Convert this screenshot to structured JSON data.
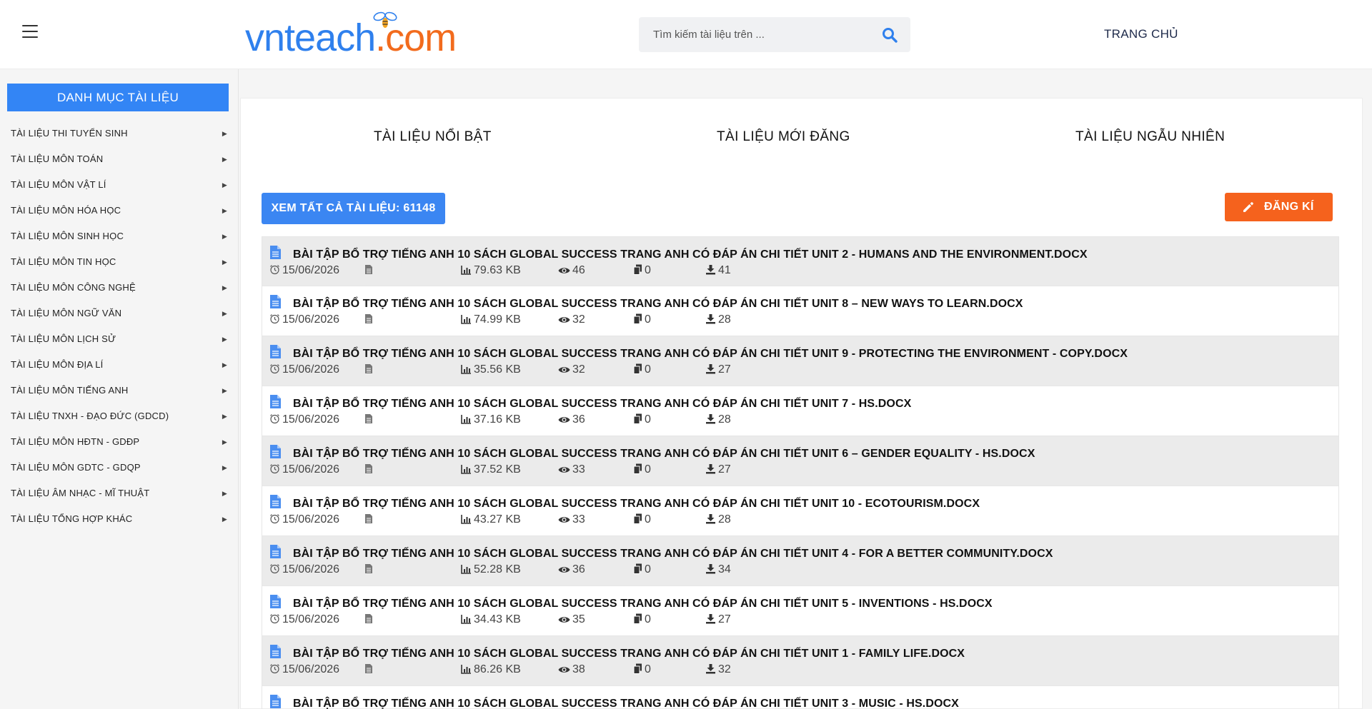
{
  "header": {
    "logo": {
      "part1": "vnteach",
      "part2": ".com"
    },
    "search": {
      "placeholder": "Tìm kiếm tài liệu trên ..."
    },
    "nav_home": "TRANG CHỦ"
  },
  "sidebar": {
    "title": "DANH MỤC TÀI LIỆU",
    "items": [
      {
        "label": "TÀI LIỆU THI TUYỂN SINH"
      },
      {
        "label": "TÀI LIỆU MÔN TOÁN"
      },
      {
        "label": "TÀI LIỆU MÔN VẬT LÍ"
      },
      {
        "label": "TÀI LIỆU MÔN HÓA HỌC"
      },
      {
        "label": "TÀI LIỆU MÔN SINH HỌC"
      },
      {
        "label": "TÀI LIỆU MÔN TIN HỌC"
      },
      {
        "label": "TÀI LIỆU MÔN CÔNG NGHỆ"
      },
      {
        "label": "TÀI LIỆU MÔN NGỮ VĂN"
      },
      {
        "label": "TÀI LIỆU MÔN LỊCH SỬ"
      },
      {
        "label": "TÀI LIỆU MÔN ĐỊA LÍ"
      },
      {
        "label": "TÀI LIỆU MÔN TIẾNG ANH"
      },
      {
        "label": "TÀI LIỆU TNXH - ĐẠO ĐỨC (GDCD)"
      },
      {
        "label": "TÀI LIỆU MÔN HĐTN - GDĐP"
      },
      {
        "label": "TÀI LIỆU MÔN GDTC - GDQP"
      },
      {
        "label": "TÀI LIỆU ÂM NHẠC - MĨ THUẬT"
      },
      {
        "label": "TÀI LIỆU TỔNG HỢP KHÁC"
      }
    ]
  },
  "tabs": [
    "TÀI LIỆU NỔI BẬT",
    "TÀI LIỆU MỚI ĐĂNG",
    "TÀI LIỆU NGẪU NHIÊN"
  ],
  "actions": {
    "view_all": "XEM TẤT CẢ TÀI LIỆU: 61148",
    "register": "ĐĂNG KÍ"
  },
  "documents": [
    {
      "title": "BÀI TẬP BỔ TRỢ TIẾNG ANH 10 SÁCH GLOBAL SUCCESS TRANG ANH CÓ ĐÁP ÁN CHI TIẾT UNIT 2 - HUMANS AND THE ENVIRONMENT.DOCX",
      "date": "15/06/2026",
      "size": "79.63 KB",
      "views": "46",
      "copies": "0",
      "downloads": "41"
    },
    {
      "title": "BÀI TẬP BỔ TRỢ TIẾNG ANH 10 SÁCH GLOBAL SUCCESS TRANG ANH CÓ ĐÁP ÁN CHI TIẾT UNIT 8 – NEW WAYS TO LEARN.DOCX",
      "date": "15/06/2026",
      "size": "74.99 KB",
      "views": "32",
      "copies": "0",
      "downloads": "28"
    },
    {
      "title": "BÀI TẬP BỔ TRỢ TIẾNG ANH 10 SÁCH GLOBAL SUCCESS TRANG ANH CÓ ĐÁP ÁN CHI TIẾT UNIT 9 - PROTECTING THE ENVIRONMENT - COPY.DOCX",
      "date": "15/06/2026",
      "size": "35.56 KB",
      "views": "32",
      "copies": "0",
      "downloads": "27"
    },
    {
      "title": "BÀI TẬP BỔ TRỢ TIẾNG ANH 10 SÁCH GLOBAL SUCCESS TRANG ANH CÓ ĐÁP ÁN CHI TIẾT UNIT 7 - HS.DOCX",
      "date": "15/06/2026",
      "size": "37.16 KB",
      "views": "36",
      "copies": "0",
      "downloads": "28"
    },
    {
      "title": "BÀI TẬP BỔ TRỢ TIẾNG ANH 10 SÁCH GLOBAL SUCCESS TRANG ANH CÓ ĐÁP ÁN CHI TIẾT UNIT 6 – GENDER EQUALITY - HS.DOCX",
      "date": "15/06/2026",
      "size": "37.52 KB",
      "views": "33",
      "copies": "0",
      "downloads": "27"
    },
    {
      "title": "BÀI TẬP BỔ TRỢ TIẾNG ANH 10 SÁCH GLOBAL SUCCESS TRANG ANH CÓ ĐÁP ÁN CHI TIẾT UNIT 10 - ECOTOURISM.DOCX",
      "date": "15/06/2026",
      "size": "43.27 KB",
      "views": "33",
      "copies": "0",
      "downloads": "28"
    },
    {
      "title": "BÀI TẬP BỔ TRỢ TIẾNG ANH 10 SÁCH GLOBAL SUCCESS TRANG ANH CÓ ĐÁP ÁN CHI TIẾT UNIT 4 - FOR A BETTER COMMUNITY.DOCX",
      "date": "15/06/2026",
      "size": "52.28 KB",
      "views": "36",
      "copies": "0",
      "downloads": "34"
    },
    {
      "title": "BÀI TẬP BỔ TRỢ TIẾNG ANH 10 SÁCH GLOBAL SUCCESS TRANG ANH CÓ ĐÁP ÁN CHI TIẾT UNIT 5 - INVENTIONS - HS.DOCX",
      "date": "15/06/2026",
      "size": "34.43 KB",
      "views": "35",
      "copies": "0",
      "downloads": "27"
    },
    {
      "title": "BÀI TẬP BỔ TRỢ TIẾNG ANH 10 SÁCH GLOBAL SUCCESS TRANG ANH CÓ ĐÁP ÁN CHI TIẾT UNIT 1 - FAMILY LIFE.DOCX",
      "date": "15/06/2026",
      "size": "86.26 KB",
      "views": "38",
      "copies": "0",
      "downloads": "32"
    },
    {
      "title": "BÀI TẬP BỔ TRỢ TIẾNG ANH 10 SÁCH GLOBAL SUCCESS TRANG ANH CÓ ĐÁP ÁN CHI TIẾT UNIT 3 - MUSIC - HS.DOCX",
      "date": "",
      "size": "",
      "views": "",
      "copies": "",
      "downloads": ""
    }
  ]
}
